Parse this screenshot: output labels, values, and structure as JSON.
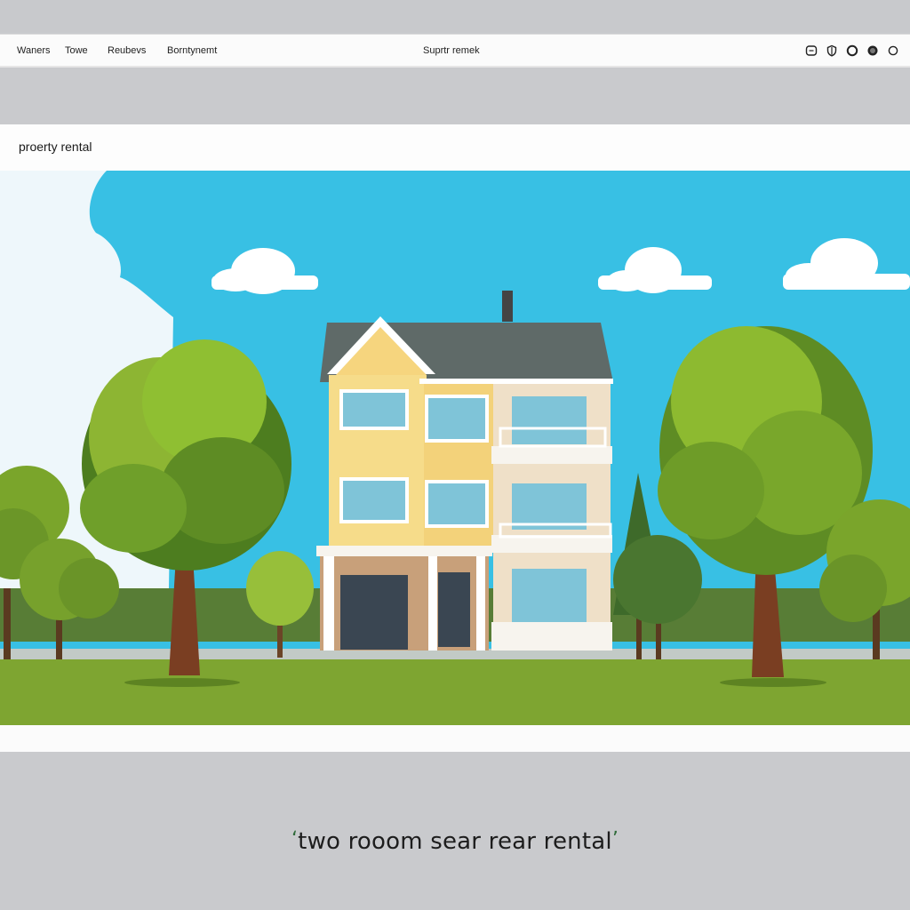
{
  "nav": {
    "items": [
      "Waners",
      "Towe",
      "Reubevs",
      "Borntynemt"
    ],
    "center": "Suprtr remek",
    "icons": [
      "chat-icon",
      "shield-icon",
      "circle-icon",
      "record-icon",
      "ring-icon"
    ]
  },
  "panel": {
    "title": "proerty rental"
  },
  "caption": {
    "text": "two rooom sear rear rental",
    "open_mark": "ʻ",
    "close_mark": "ʼ"
  },
  "colors": {
    "sky": "#38c0e4",
    "grass": "#7ea531",
    "house_wall": "#f6dc8a",
    "roof": "#5f6a68",
    "accent": "#2f6b3a"
  }
}
